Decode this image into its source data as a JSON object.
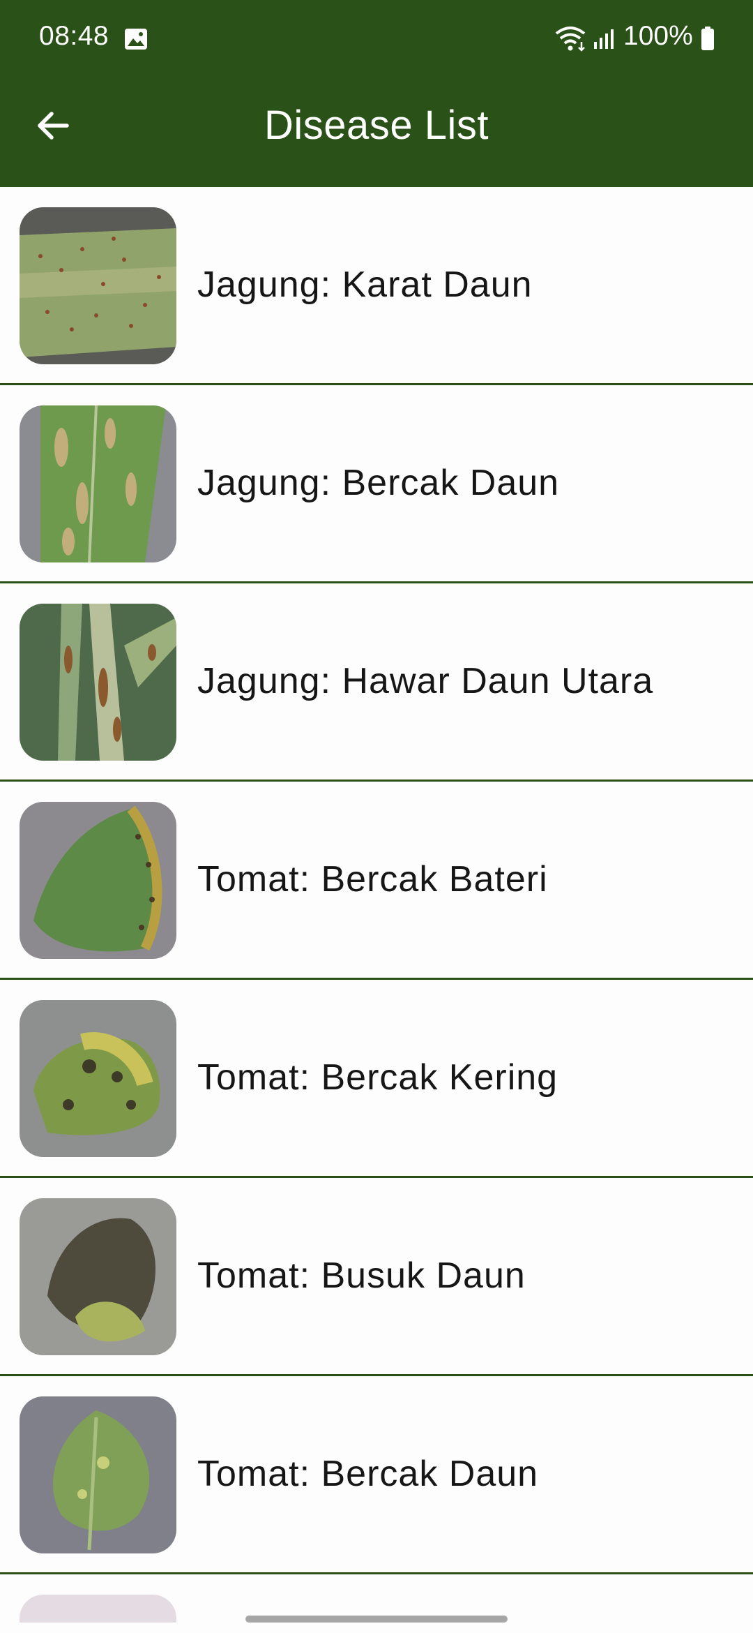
{
  "status_bar": {
    "time": "08:48",
    "battery": "100%",
    "icons": [
      "gallery-icon",
      "wifi-icon",
      "signal-icon",
      "battery-icon"
    ]
  },
  "app_bar": {
    "title": "Disease List",
    "back_icon": "arrow-left-icon",
    "background": "#2A5117"
  },
  "diseases": [
    {
      "label": "Jagung: Karat Daun",
      "thumbnail": "corn-leaf-rust-photo"
    },
    {
      "label": "Jagung: Bercak Daun",
      "thumbnail": "corn-leaf-spot-photo"
    },
    {
      "label": "Jagung: Hawar Daun Utara",
      "thumbnail": "corn-northern-blight-photo"
    },
    {
      "label": "Tomat: Bercak Bateri",
      "thumbnail": "tomato-bacterial-spot-photo"
    },
    {
      "label": "Tomat: Bercak Kering",
      "thumbnail": "tomato-early-blight-photo"
    },
    {
      "label": "Tomat: Busuk Daun",
      "thumbnail": "tomato-late-blight-photo"
    },
    {
      "label": "Tomat: Bercak Daun",
      "thumbnail": "tomato-leaf-spot-photo"
    }
  ],
  "colors": {
    "accent": "#2A5117",
    "divider": "#2A5117",
    "text": "#161616",
    "background": "#FDFDFD"
  }
}
